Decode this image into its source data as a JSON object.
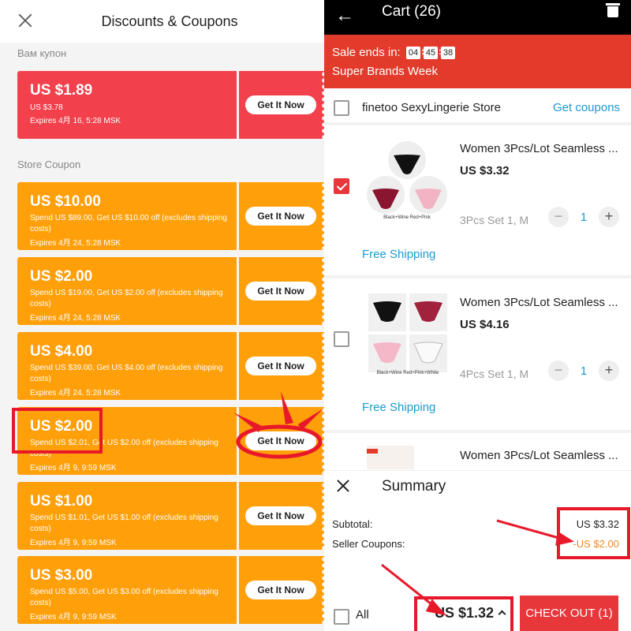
{
  "left": {
    "title": "Discounts & Coupons",
    "section_user": "Вам купон",
    "section_store": "Store Coupon",
    "button_label": "Get It Now",
    "user_coupon": {
      "amount": "US $1.89",
      "desc": "US $3.78",
      "expires": "Expires 4月 16, 5:28 MSK",
      "color": "#f2414d"
    },
    "store_coupons": [
      {
        "amount": "US $10.00",
        "desc": "Spend US $89.00, Get US $10.00 off (excludes shipping costs)",
        "expires": "Expires 4月 24, 5:28 MSK"
      },
      {
        "amount": "US $2.00",
        "desc": "Spend US $19.00, Get US $2.00 off (excludes shipping costs)",
        "expires": "Expires 4月 24, 5:28 MSK"
      },
      {
        "amount": "US $4.00",
        "desc": "Spend US $39.00, Get US $4.00 off (excludes shipping costs)",
        "expires": "Expires 4月 24, 5:28 MSK"
      },
      {
        "amount": "US $2.00",
        "desc": "Spend US $2.01, Get US $2.00 off (excludes shipping costs)",
        "expires": "Expires 4月 9, 9:59 MSK"
      },
      {
        "amount": "US $1.00",
        "desc": "Spend US $1.01, Get US $1.00 off (excludes shipping costs)",
        "expires": "Expires 4月 9, 9:59 MSK"
      },
      {
        "amount": "US $3.00",
        "desc": "Spend US $5.00, Get US $3.00 off (excludes shipping costs)",
        "expires": "Expires 4月 9, 9:59 MSK"
      }
    ],
    "store_coupon_color": "#ff9f0a"
  },
  "right": {
    "title": "Cart (26)",
    "sale_label": "Sale ends in:",
    "timer": [
      "04",
      "45",
      "38"
    ],
    "sale_sub": "Super Brands Week",
    "store_name": "finetoo SexyLingerie Store",
    "get_coupons": "Get coupons",
    "products": [
      {
        "title": "Women 3Pcs/Lot Seamless ...",
        "price": "US $3.32",
        "variant": "3Pcs Set 1, M",
        "qty": "1",
        "shipping": "Free Shipping",
        "checked": true,
        "img_caption": "Black+Wine Red+Pink"
      },
      {
        "title": "Women 3Pcs/Lot Seamless ...",
        "price": "US $4.16",
        "variant": "4Pcs Set 1, M",
        "qty": "1",
        "shipping": "Free Shipping",
        "checked": false,
        "img_caption": "Black+Wine Red+Pink+White"
      },
      {
        "title": "Women 3Pcs/Lot Seamless ..."
      }
    ],
    "summary": {
      "title": "Summary",
      "subtotal_label": "Subtotal:",
      "subtotal_value": "US $3.32",
      "coupons_label": "Seller Coupons:",
      "coupons_value": "-US $2.00",
      "all_label": "All",
      "total": "US $1.32",
      "checkout": "CHECK OUT (1)"
    },
    "accent_red": "#e8373a",
    "link_blue": "#1b9ad1"
  }
}
